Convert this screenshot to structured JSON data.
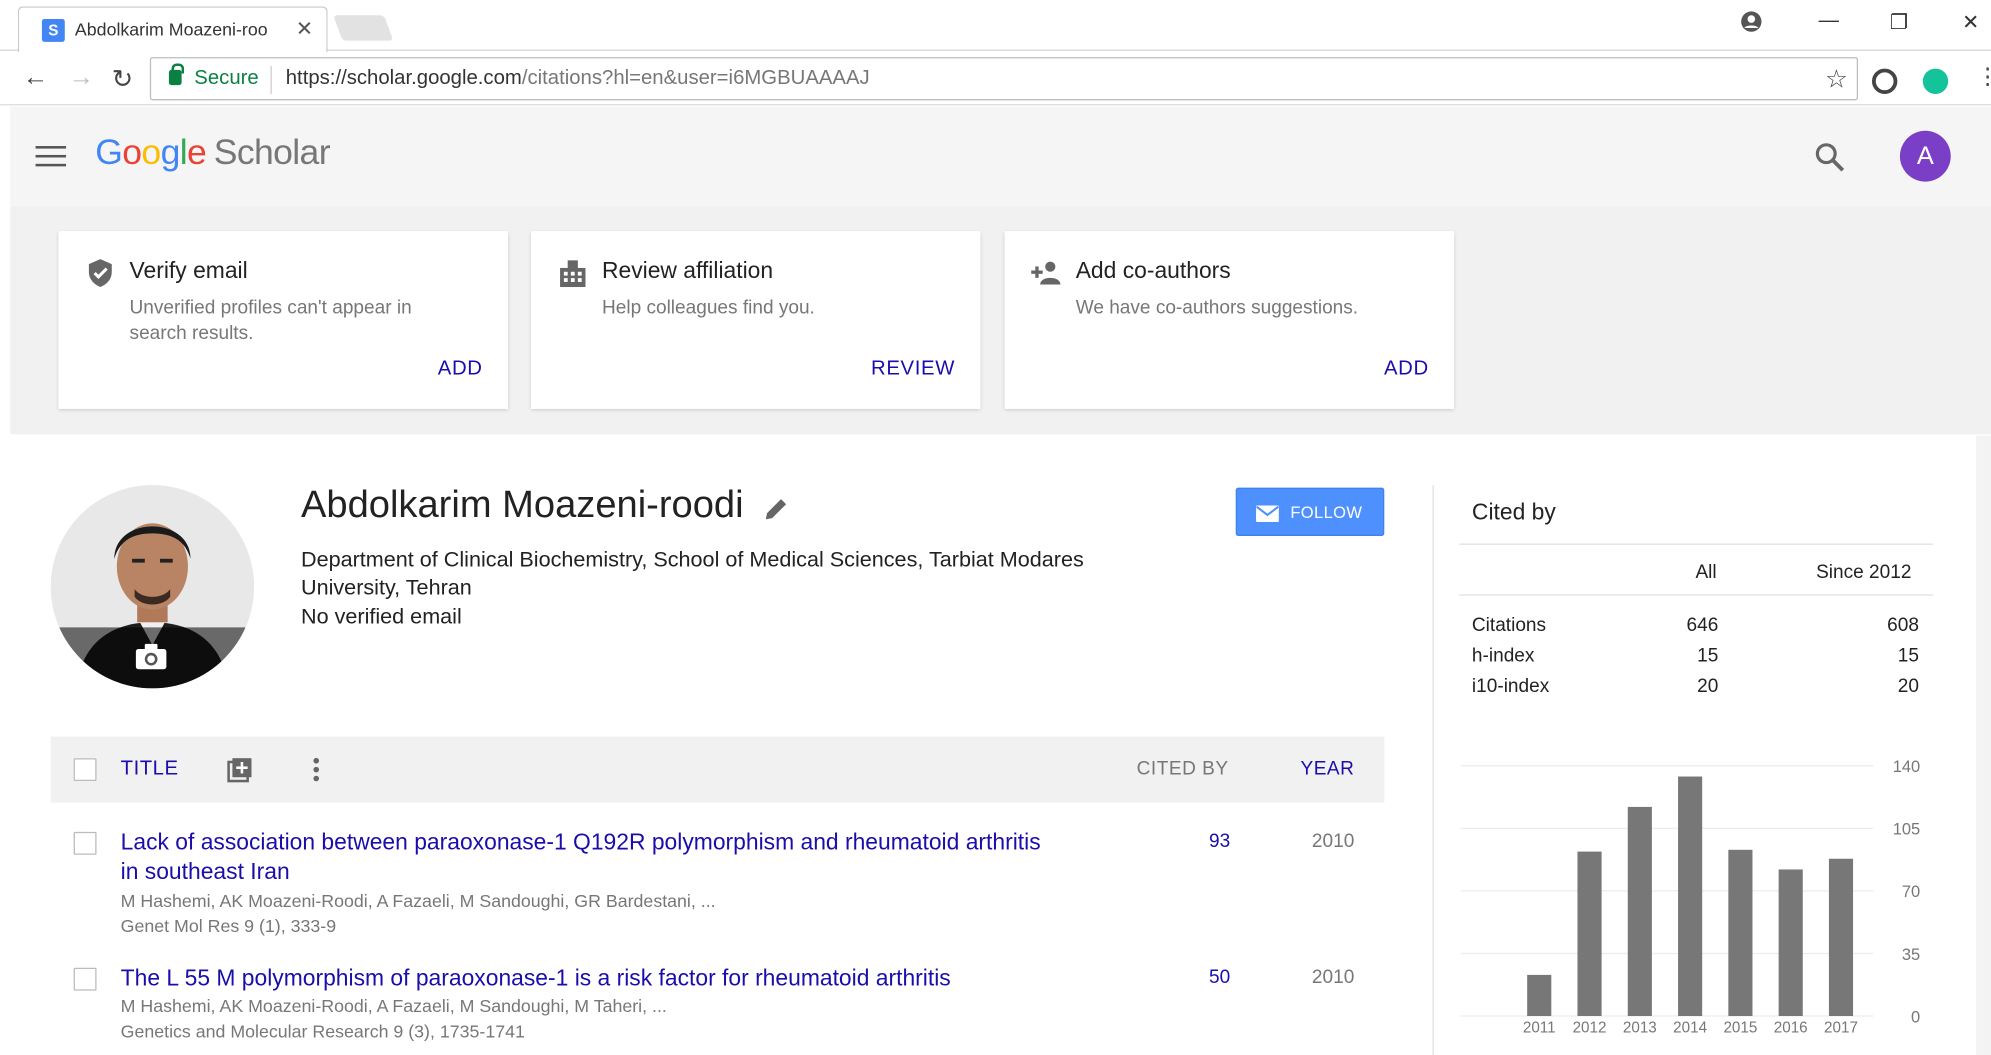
{
  "browser": {
    "tab_title": "Abdolkarim Moazeni-roo",
    "secure_label": "Secure",
    "url_host": "https://scholar.google.com",
    "url_path": "/citations?hl=en&user=i6MGBUAAAAJ"
  },
  "header": {
    "logo_google": "Google",
    "logo_scholar": "Scholar",
    "avatar_letter": "A"
  },
  "cards": [
    {
      "title": "Verify email",
      "desc": "Unverified profiles can't appear in search results.",
      "action": "ADD",
      "icon": "shield-check-icon"
    },
    {
      "title": "Review affiliation",
      "desc": "Help colleagues find you.",
      "action": "REVIEW",
      "icon": "building-icon"
    },
    {
      "title": "Add co-authors",
      "desc": "We have co-authors suggestions.",
      "action": "ADD",
      "icon": "add-person-icon"
    }
  ],
  "profile": {
    "name": "Abdolkarim Moazeni-roodi",
    "affiliation": "Department of Clinical Biochemistry, School of Medical Sciences, Tarbiat Modares University, Tehran",
    "email": "No verified email",
    "follow_label": "FOLLOW"
  },
  "table": {
    "col_title": "TITLE",
    "col_cited": "CITED BY",
    "col_year": "YEAR",
    "rows": [
      {
        "title": "Lack of association between paraoxonase-1 Q192R polymorphism and rheumatoid arthritis in southeast Iran",
        "authors": "M Hashemi, AK Moazeni-Roodi, A Fazaeli, M Sandoughi, GR Bardestani, ...",
        "venue": "Genet Mol Res 9 (1), 333-9",
        "cited": "93",
        "year": "2010"
      },
      {
        "title": "The L 55 M polymorphism of paraoxonase-1 is a risk factor for rheumatoid arthritis",
        "authors": "M Hashemi, AK Moazeni-Roodi, A Fazaeli, M Sandoughi, M Taheri, ...",
        "venue": "Genetics and Molecular Research 9 (3), 1735-1741",
        "cited": "50",
        "year": "2010"
      }
    ]
  },
  "cited_by": {
    "title": "Cited by",
    "col_all": "All",
    "col_since": "Since 2012",
    "metrics": [
      {
        "label": "Citations",
        "all": "646",
        "since": "608"
      },
      {
        "label": "h-index",
        "all": "15",
        "since": "15"
      },
      {
        "label": "i10-index",
        "all": "20",
        "since": "20"
      }
    ]
  },
  "chart_data": {
    "type": "bar",
    "categories": [
      "2011",
      "2012",
      "2013",
      "2014",
      "2015",
      "2016",
      "2017"
    ],
    "values": [
      23,
      92,
      117,
      134,
      93,
      82,
      88
    ],
    "ylim": [
      0,
      140
    ],
    "yticks": [
      "0",
      "35",
      "70",
      "105",
      "140"
    ],
    "y_axis_side": "right",
    "grid": true,
    "bar_color": "#777777"
  }
}
